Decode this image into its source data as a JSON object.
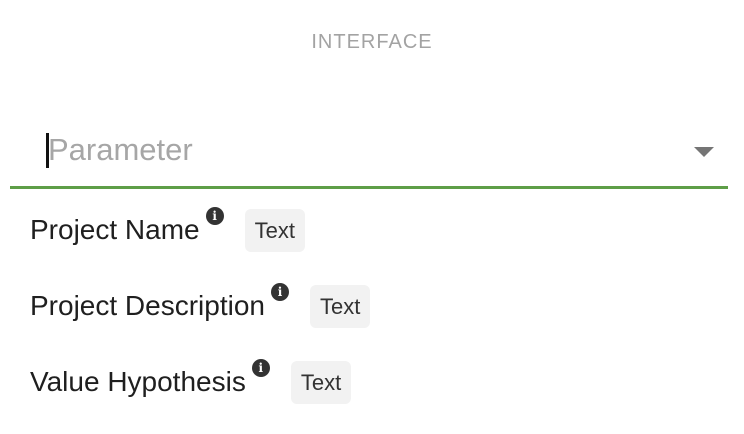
{
  "section": {
    "title": "INTERFACE"
  },
  "parameter_select": {
    "placeholder": "Parameter",
    "value": ""
  },
  "options": [
    {
      "label": "Project Name",
      "info_icon": "info-icon",
      "type": "Text"
    },
    {
      "label": "Project Description",
      "info_icon": "info-icon",
      "type": "Text"
    },
    {
      "label": "Value Hypothesis",
      "info_icon": "info-icon",
      "type": "Text"
    }
  ],
  "icons": {
    "info_glyph": "i"
  },
  "colors": {
    "focus_underline": "#5e9e47",
    "placeholder": "#a6a6a6",
    "section_title": "#a3a3a3",
    "badge_background": "#f2f2f2"
  }
}
